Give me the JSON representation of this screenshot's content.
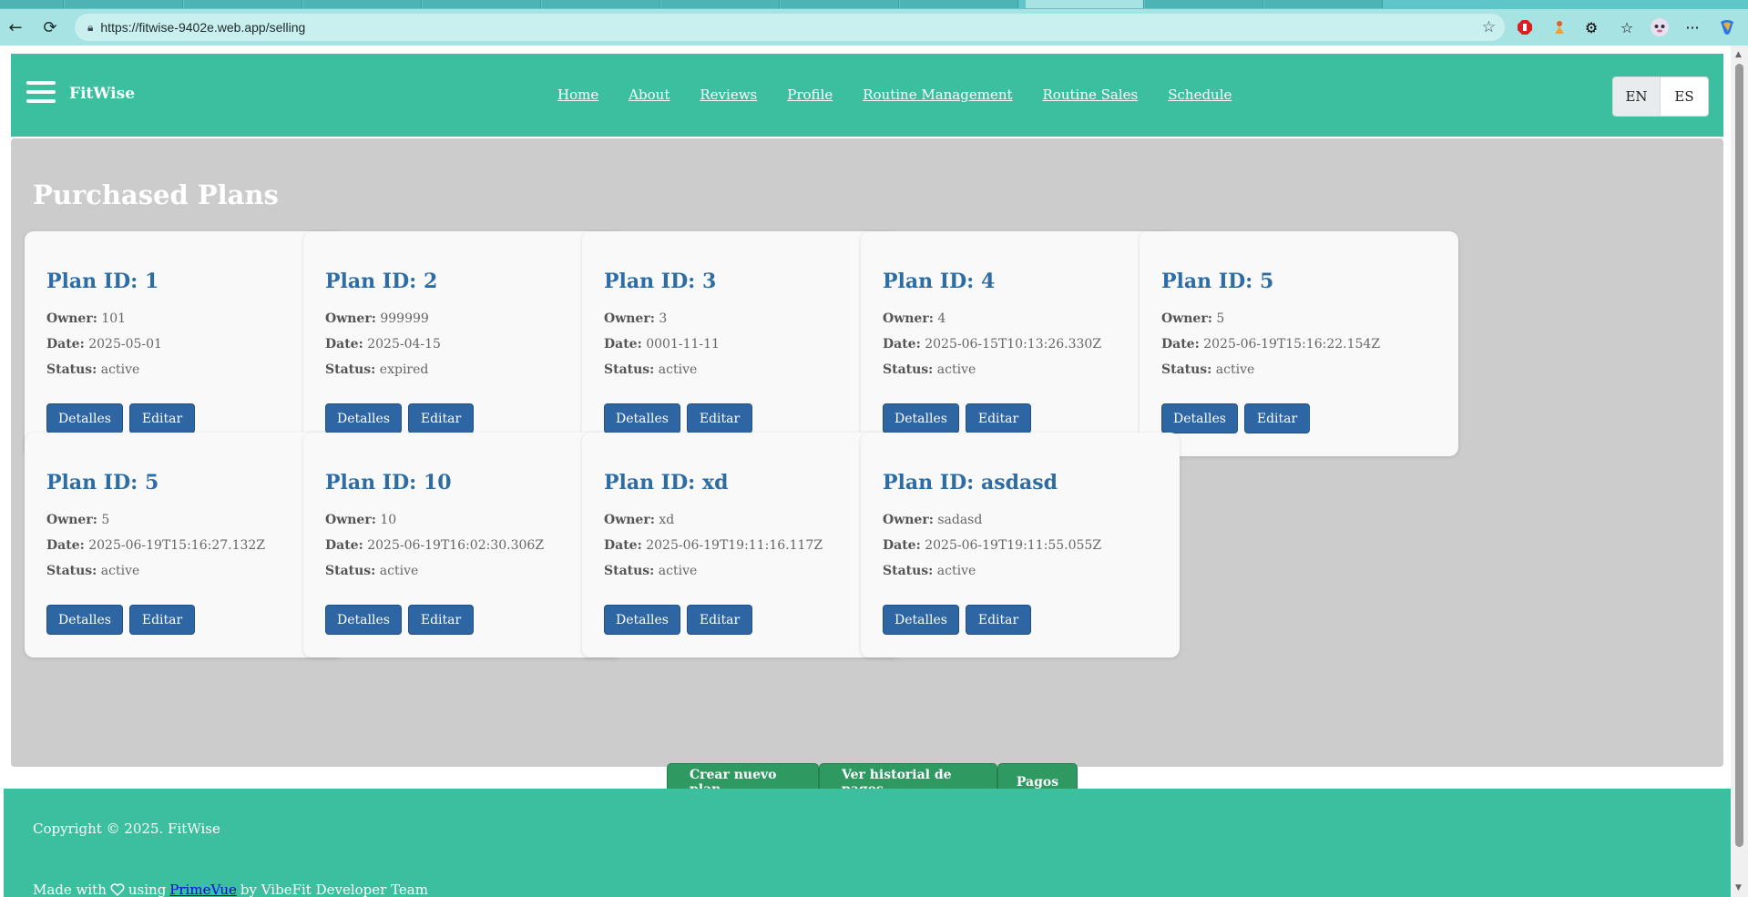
{
  "browser": {
    "url": "https://fitwise-9402e.web.app/selling"
  },
  "nav": {
    "brand": "FitWise",
    "links": [
      "Home",
      "About",
      "Reviews",
      "Profile",
      "Routine Management",
      "Routine Sales",
      "Schedule"
    ],
    "lang_en": "EN",
    "lang_es": "ES"
  },
  "main": {
    "title": "Purchased Plans",
    "labels": {
      "owner": "Owner:",
      "date": "Date:",
      "status": "Status:"
    },
    "details_label": "Detalles",
    "edit_label": "Editar",
    "plans": [
      {
        "id": "Plan ID: 1",
        "owner": "101",
        "date": "2025-05-01",
        "status": "active"
      },
      {
        "id": "Plan ID: 2",
        "owner": "999999",
        "date": "2025-04-15",
        "status": "expired"
      },
      {
        "id": "Plan ID: 3",
        "owner": "3",
        "date": "0001-11-11",
        "status": "active"
      },
      {
        "id": "Plan ID: 4",
        "owner": "4",
        "date": "2025-06-15T10:13:26.330Z",
        "status": "active"
      },
      {
        "id": "Plan ID: 5",
        "owner": "5",
        "date": "2025-06-19T15:16:22.154Z",
        "status": "active"
      },
      {
        "id": "Plan ID: 5",
        "owner": "5",
        "date": "2025-06-19T15:16:27.132Z",
        "status": "active"
      },
      {
        "id": "Plan ID: 10",
        "owner": "10",
        "date": "2025-06-19T16:02:30.306Z",
        "status": "active"
      },
      {
        "id": "Plan ID: xd",
        "owner": "xd",
        "date": "2025-06-19T19:11:16.117Z",
        "status": "active"
      },
      {
        "id": "Plan ID: asdasd",
        "owner": "sadasd",
        "date": "2025-06-19T19:11:55.055Z",
        "status": "active"
      }
    ],
    "actions": {
      "create": "Crear nuevo plan",
      "history": "Ver historial de pagos",
      "payments": "Pagos"
    }
  },
  "footer": {
    "copyright": "Copyright © 2025. FitWise",
    "made_prefix": "Made with",
    "made_using": "using",
    "made_link": "PrimeVue",
    "made_suffix": "by VibeFit Developer Team"
  }
}
